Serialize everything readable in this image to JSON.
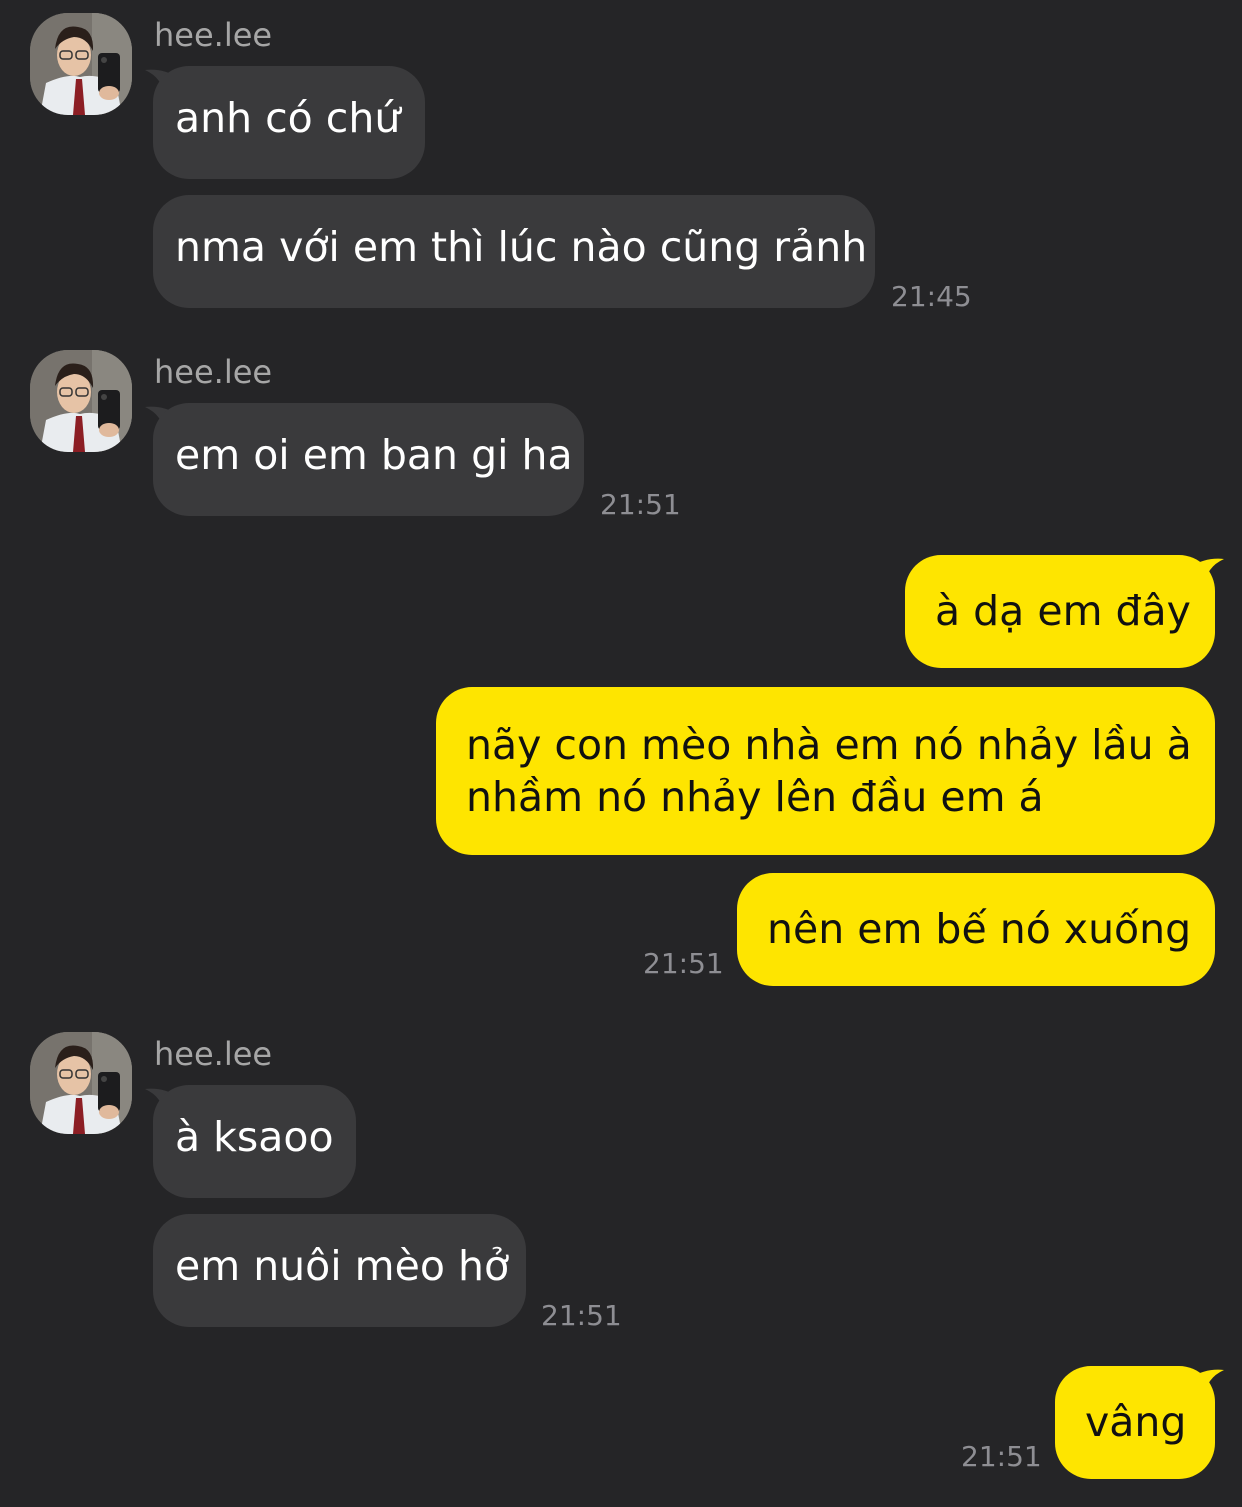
{
  "theme": {
    "background": "#252527",
    "incoming_bubble": "#3a3a3c",
    "outgoing_bubble": "#fee500",
    "incoming_text": "#ffffff",
    "outgoing_text": "#111111",
    "timestamp_color": "#8e8e93"
  },
  "chat": {
    "group1": {
      "sender": "hee.lee",
      "messages": [
        "anh có chứ",
        "nma với em thì lúc nào cũng rảnh"
      ],
      "time": "21:45"
    },
    "group2": {
      "sender": "hee.lee",
      "messages": [
        "em oi em ban gi ha"
      ],
      "time": "21:51"
    },
    "group3": {
      "messages": [
        "à dạ em đây",
        "nãy con mèo nhà em nó nhảy lầu à",
        "nhầm nó nhảy lên đầu em á",
        "nên em bế nó xuống"
      ],
      "time": "21:51"
    },
    "group4": {
      "sender": "hee.lee",
      "messages": [
        "à ksaoo",
        "em nuôi mèo hở"
      ],
      "time": "21:51"
    },
    "group5": {
      "messages": [
        "vâng"
      ],
      "time": "21:51"
    }
  }
}
